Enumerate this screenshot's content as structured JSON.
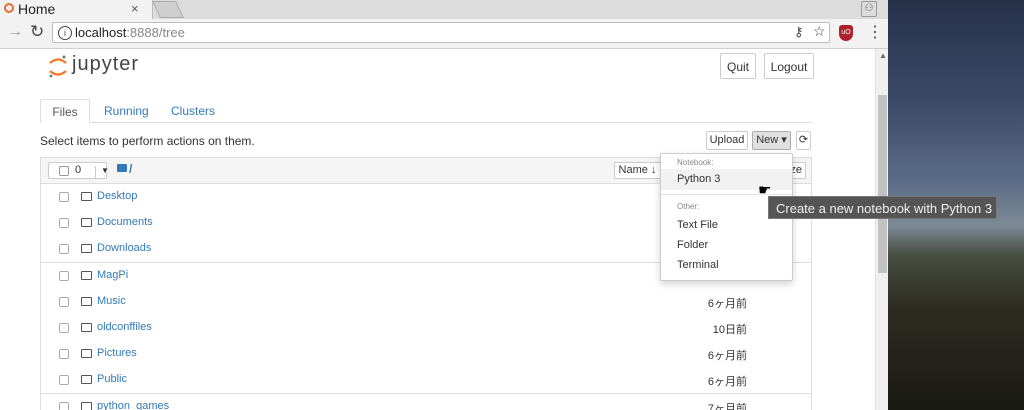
{
  "browser": {
    "tab_title": "Home",
    "tab_close": "×",
    "url_host": "localhost",
    "url_rest": ":8888/tree"
  },
  "header": {
    "logo_text": "jupyter",
    "quit_label": "Quit",
    "logout_label": "Logout",
    "logo_color": "#f37726"
  },
  "tabs": [
    {
      "label": "Files"
    },
    {
      "label": "Running"
    },
    {
      "label": "Clusters"
    }
  ],
  "toolbar": {
    "select_message": "Select items to perform actions on them.",
    "upload_label": "Upload",
    "new_label": "New ▾",
    "refresh_icon": "refresh-icon"
  },
  "list": {
    "selected_count": "0",
    "path": "/",
    "sort_name_label": "Name ↓",
    "sort_size_label": "ze",
    "rows": [
      {
        "name": "Desktop",
        "time": ""
      },
      {
        "name": "Documents",
        "time": ""
      },
      {
        "name": "Downloads",
        "time": ""
      },
      {
        "name": "MagPi",
        "time": ""
      },
      {
        "name": "Music",
        "time": "6ヶ月前"
      },
      {
        "name": "oldconffiles",
        "time": "10日前"
      },
      {
        "name": "Pictures",
        "time": "6ヶ月前"
      },
      {
        "name": "Public",
        "time": "6ヶ月前"
      },
      {
        "name": "python_games",
        "time": "7ヶ月前"
      }
    ]
  },
  "new_menu": {
    "notebook_header": "Notebook:",
    "notebook_item": "Python 3",
    "other_header": "Other:",
    "other_items": [
      "Text File",
      "Folder",
      "Terminal"
    ]
  },
  "tooltip": "Create a new notebook with Python 3",
  "colors": {
    "link": "#337ab7"
  }
}
